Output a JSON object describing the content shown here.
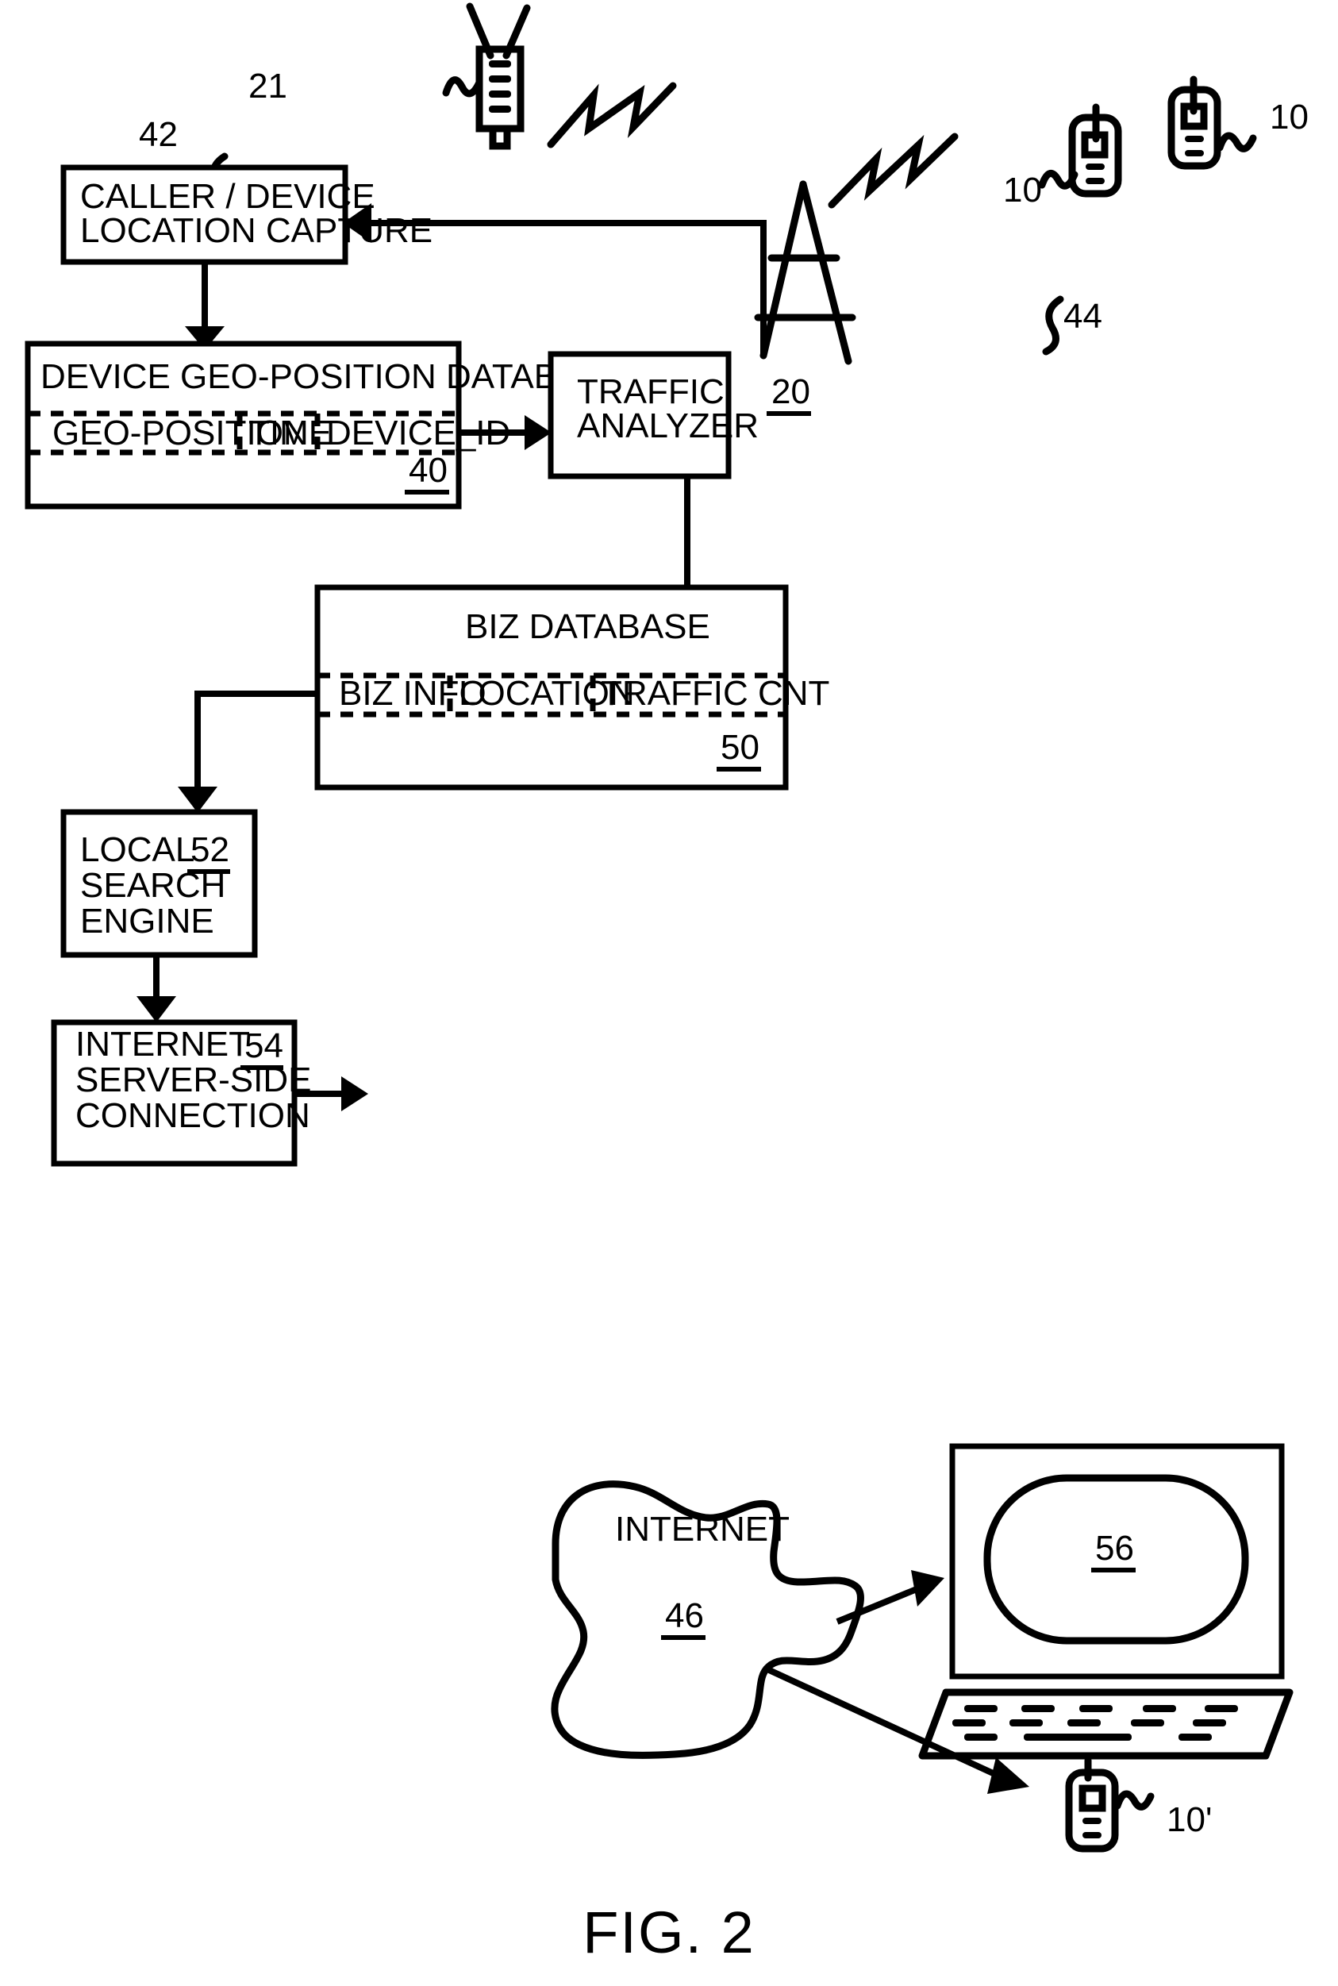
{
  "figure": {
    "caption": "FIG. 2"
  },
  "nodes": {
    "caller_capture": {
      "line1": "CALLER / DEVICE",
      "line2": "LOCATION CAPTURE",
      "ref": "42"
    },
    "geo_db": {
      "title": "DEVICE GEO-POSITION DATABASE",
      "columns": [
        "GEO-POSITION",
        "TIME",
        "DEVICE_ID"
      ],
      "ref": "40"
    },
    "traffic_analyzer": {
      "line1": "TRAFFIC",
      "line2": "ANALYZER",
      "ref": "44"
    },
    "biz_db": {
      "title": "BIZ DATABASE",
      "columns": [
        "BIZ INFO",
        "LOCATION",
        "TRAFFIC CNT"
      ],
      "ref": "50"
    },
    "local_search": {
      "line1": "LOCAL",
      "line2": "SEARCH",
      "line3": "ENGINE",
      "ref": "52"
    },
    "server_side": {
      "line1": "INTERNET",
      "line2": "SERVER-SIDE",
      "line3": "CONNECTION",
      "ref": "54"
    },
    "internet_cloud": {
      "label": "INTERNET",
      "ref": "46"
    },
    "laptop": {
      "ref": "56"
    },
    "base_station": {
      "ref": "21",
      "icon": "base-station-antenna-icon"
    },
    "cell_tower": {
      "ref": "20",
      "icon": "cell-tower-icon"
    },
    "mobile_left": {
      "ref": "10",
      "icon": "mobile-phone-icon"
    },
    "mobile_right": {
      "ref": "10",
      "icon": "mobile-phone-icon"
    },
    "mobile_client": {
      "ref": "10'",
      "icon": "mobile-phone-icon"
    }
  }
}
